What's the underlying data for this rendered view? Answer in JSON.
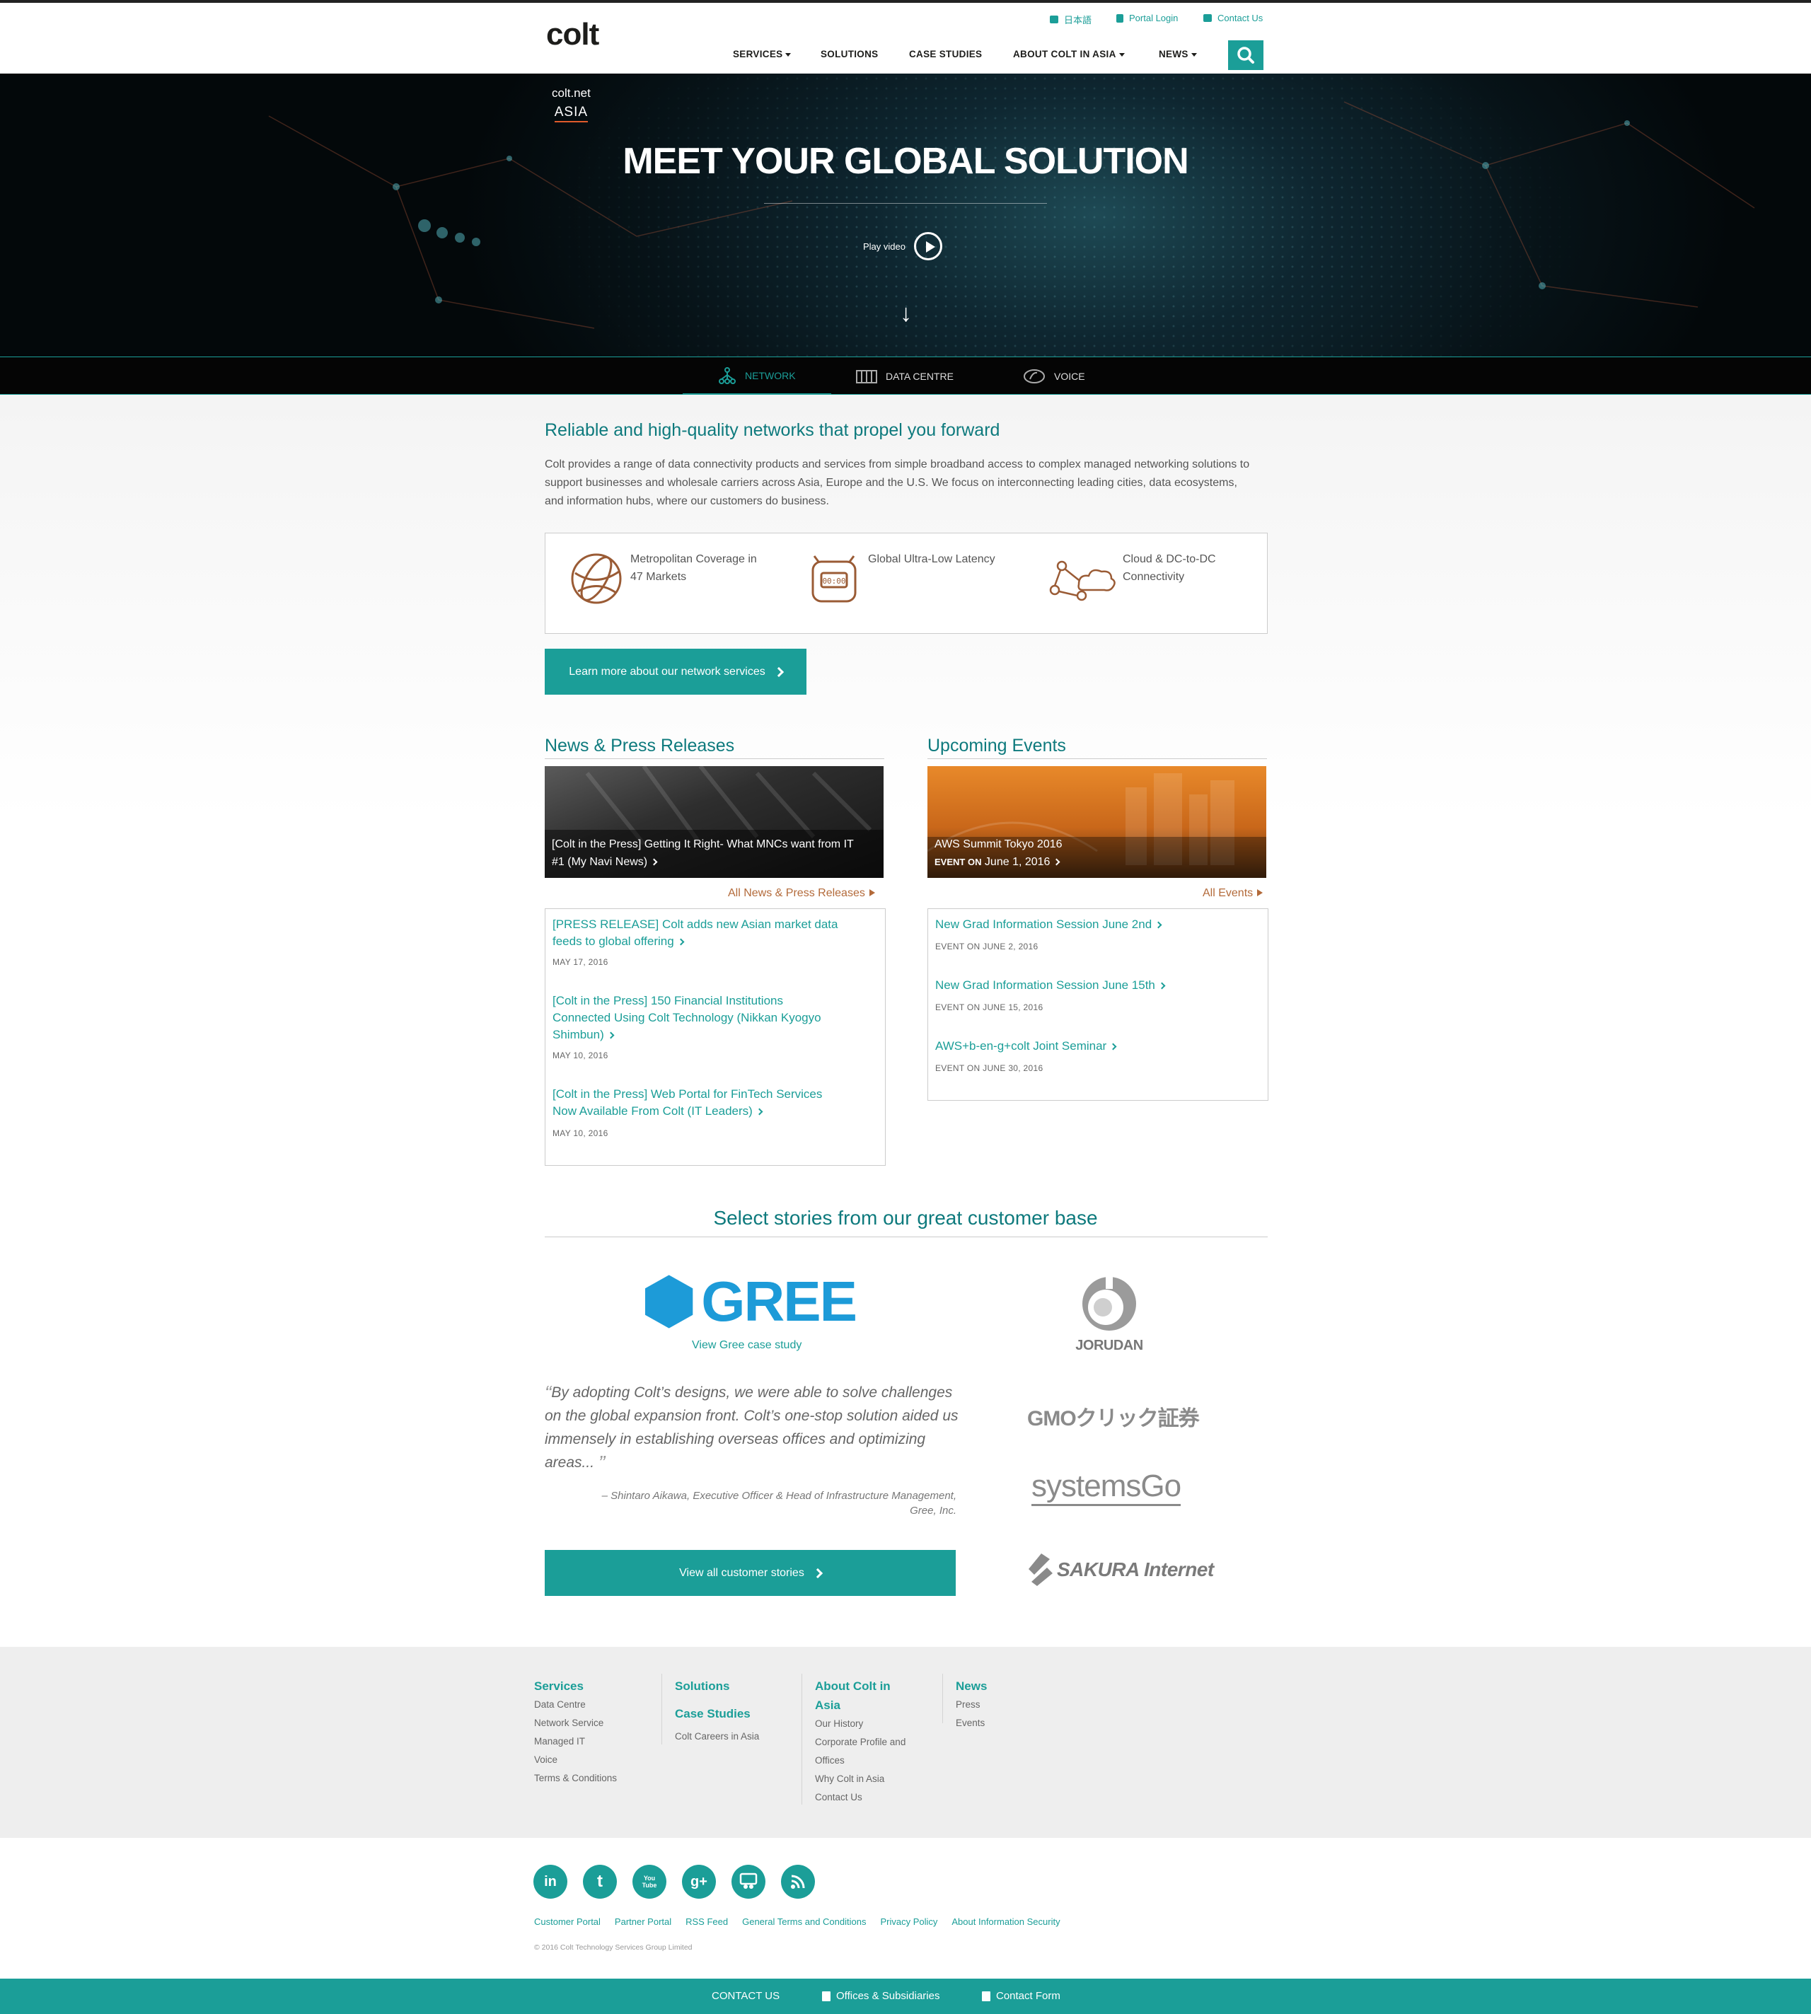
{
  "header": {
    "logo": "colt",
    "util": {
      "japanese": "日本語",
      "portal_login": "Portal Login",
      "contact_us": "Contact Us"
    },
    "nav": [
      "SERVICES",
      "SOLUTIONS",
      "CASE STUDIES",
      "ABOUT COLT IN ASIA",
      "NEWS"
    ]
  },
  "hero": {
    "brand_line1": "colt.net",
    "brand_line2": "ASIA",
    "title": "MEET YOUR GLOBAL SOLUTION",
    "play_label": "Play video",
    "arrow": "↓"
  },
  "tabs": {
    "network": "NETWORK",
    "datacentre": "DATA CENTRE",
    "voice": "VOICE"
  },
  "network": {
    "heading": "Reliable and high-quality networks that propel you forward",
    "intro": "Colt provides a range of data connectivity products and services from simple broadband access to complex managed networking solutions to support businesses and wholesale carriers across Asia, Europe and the U.S. We focus on interconnecting leading cities, data ecosystems, and information hubs, where our customers do business.",
    "features": [
      {
        "icon": "globe-icon",
        "line1": "Metropolitan Coverage in",
        "line2": "47 Markets"
      },
      {
        "icon": "stopwatch-icon",
        "line1": "Global Ultra-Low Latency",
        "line2": ""
      },
      {
        "icon": "cloud-network-icon",
        "line1": "Cloud & DC-to-DC",
        "line2": "Connectivity"
      }
    ],
    "cta": "Learn more about our network services"
  },
  "news": {
    "heading": "News & Press Releases",
    "featured_line1": "[Colt in the Press] Getting It Right- What MNCs want from IT",
    "featured_line2": "#1 (My Navi News)",
    "all_link": "All News & Press Releases",
    "items": [
      {
        "l1": "[PRESS RELEASE] Colt adds new Asian market data",
        "l2": "feeds to global offering",
        "l3": "",
        "date": "MAY 17, 2016"
      },
      {
        "l1": "[Colt in the Press] 150 Financial Institutions",
        "l2": "Connected Using Colt Technology (Nikkan Kyogyo",
        "l3": "Shimbun)",
        "date": "MAY 10, 2016"
      },
      {
        "l1": "[Colt in the Press] Web Portal for FinTech Services",
        "l2": "Now Available From Colt (IT Leaders)",
        "l3": "",
        "date": "MAY 10, 2016"
      }
    ]
  },
  "events": {
    "heading": "Upcoming Events",
    "featured_title": "AWS Summit Tokyo 2016",
    "featured_prefix": "EVENT ON",
    "featured_date": "June 1, 2016",
    "all_link": "All Events",
    "items": [
      {
        "title": "New Grad Information Session June 2nd",
        "date": "EVENT ON JUNE 2, 2016"
      },
      {
        "title": "New Grad Information Session June 15th",
        "date": "EVENT ON JUNE 15, 2016"
      },
      {
        "title": "AWS+b-en-g+colt Joint Seminar",
        "date": "EVENT ON JUNE 30, 2016"
      }
    ]
  },
  "customers": {
    "heading": "Select stories from our great customer base",
    "featured_logo": "GREE",
    "case_link": "View Gree case study",
    "quote": "By adopting Colt’s designs, we were able to solve challenges on the global expansion front. Colt’s one-stop solution aided us immensely in establishing overseas offices and optimizing areas...",
    "author_line1": "– Shintaro Aikawa, Executive Officer & Head of Infrastructure Management,",
    "author_line2": "Gree, Inc.",
    "cta": "View all customer stories",
    "logos": [
      "JORUDAN",
      "GMOクリック証券",
      "systemsGo",
      "SAKURA Internet"
    ]
  },
  "footer": {
    "services": {
      "heading": "Services",
      "items": [
        "Data Centre",
        "Network Service",
        "Managed IT",
        "Voice",
        "Terms & Conditions"
      ]
    },
    "solutions": {
      "heading": "Solutions"
    },
    "case_studies": {
      "heading": "Case Studies",
      "items": [
        "Colt Careers in Asia"
      ]
    },
    "about": {
      "heading_l1": "About Colt in",
      "heading_l2": "Asia",
      "items": [
        "Our History",
        "Corporate Profile and",
        "Offices",
        "Why Colt in Asia",
        "Contact Us"
      ]
    },
    "news": {
      "heading": "News",
      "items": [
        "Press",
        "Events"
      ]
    },
    "social": [
      "in",
      "t",
      "You Tube",
      "g+",
      "slideshare",
      "rss"
    ],
    "links": [
      "Customer Portal",
      "Partner Portal",
      "RSS Feed",
      "General Terms and Conditions",
      "Privacy Policy",
      "About Information Security"
    ],
    "copyright": "© 2016 Colt Technology Services Group Limited"
  },
  "bottom_bar": {
    "contact": "CONTACT US",
    "offices": "Offices & Subsidiaries",
    "form": "Contact Form"
  },
  "colors": {
    "teal": "#1b9e98",
    "dark_teal": "#0e7a7d",
    "accent_brown": "#b36a3a",
    "hero_dark": "#071318"
  }
}
